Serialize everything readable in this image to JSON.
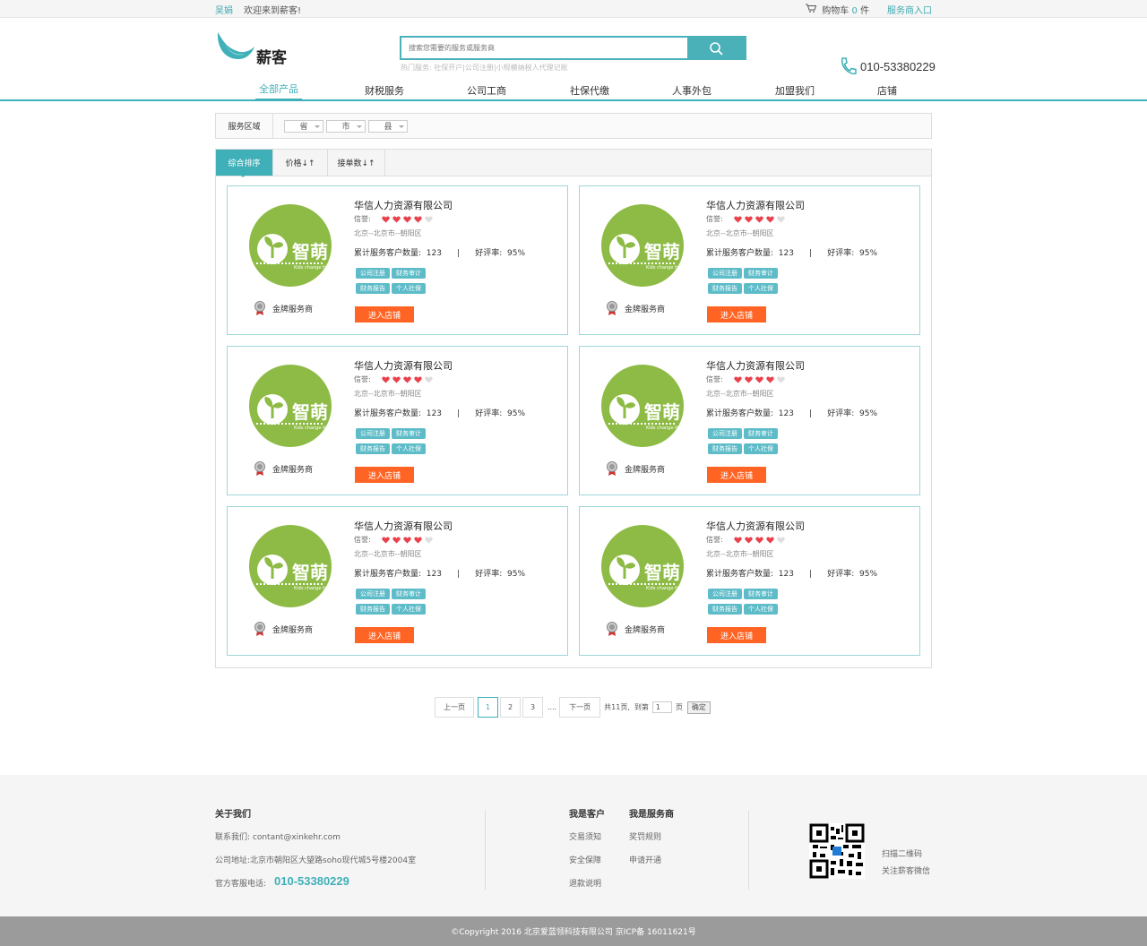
{
  "topbar": {
    "user": "吴娟",
    "welcome": "欢迎来到薪客!",
    "cart_label": "购物车",
    "cart_count": "0",
    "cart_unit": "件",
    "provider_entry": "服务商入口"
  },
  "header": {
    "logo_text": "薪客",
    "search_placeholder": "搜索您需要的服务或服务商",
    "hot_services": "热门服务:  社保开户|公司注册|小规模纳税人代理记账",
    "phone": "010-53380229"
  },
  "nav": [
    "全部产品",
    "财税服务",
    "公司工商",
    "社保代缴",
    "人事外包",
    "加盟我们",
    "店铺"
  ],
  "filter": {
    "label": "服务区域",
    "province": "省",
    "city": "市",
    "county": "县"
  },
  "sort_tabs": [
    "综合排序",
    "价格↓↑",
    "接单数↓↑"
  ],
  "cards": [
    {
      "name": "华信人力资源有限公司",
      "rep_label": "信誉:",
      "rating": 4,
      "location": "北京--北京市--朝阳区",
      "stats": "累计服务客户数量:  123      |      好评率:  95%",
      "tags": [
        "公司注册",
        "财务审计",
        "财务报告",
        "个人社保"
      ],
      "badge": "金牌服务商",
      "enter": "进入店铺",
      "logo_text": "智萌",
      "logo_sub": "Kids change the world"
    },
    {
      "name": "华信人力资源有限公司",
      "rep_label": "信誉:",
      "rating": 4,
      "location": "北京--北京市--朝阳区",
      "stats": "累计服务客户数量:  123      |      好评率:  95%",
      "tags": [
        "公司注册",
        "财务审计",
        "财务报告",
        "个人社保"
      ],
      "badge": "金牌服务商",
      "enter": "进入店铺",
      "logo_text": "智萌",
      "logo_sub": "Kids change the world"
    },
    {
      "name": "华信人力资源有限公司",
      "rep_label": "信誉:",
      "rating": 4,
      "location": "北京--北京市--朝阳区",
      "stats": "累计服务客户数量:  123      |      好评率:  95%",
      "tags": [
        "公司注册",
        "财务审计",
        "财务报告",
        "个人社保"
      ],
      "badge": "金牌服务商",
      "enter": "进入店铺",
      "logo_text": "智萌",
      "logo_sub": "Kids change the world"
    },
    {
      "name": "华信人力资源有限公司",
      "rep_label": "信誉:",
      "rating": 4,
      "location": "北京--北京市--朝阳区",
      "stats": "累计服务客户数量:  123      |      好评率:  95%",
      "tags": [
        "公司注册",
        "财务审计",
        "财务报告",
        "个人社保"
      ],
      "badge": "金牌服务商",
      "enter": "进入店铺",
      "logo_text": "智萌",
      "logo_sub": "Kids change the world"
    },
    {
      "name": "华信人力资源有限公司",
      "rep_label": "信誉:",
      "rating": 4,
      "location": "北京--北京市--朝阳区",
      "stats": "累计服务客户数量:  123      |      好评率:  95%",
      "tags": [
        "公司注册",
        "财务审计",
        "财务报告",
        "个人社保"
      ],
      "badge": "金牌服务商",
      "enter": "进入店铺",
      "logo_text": "智萌",
      "logo_sub": "Kids change the world"
    },
    {
      "name": "华信人力资源有限公司",
      "rep_label": "信誉:",
      "rating": 4,
      "location": "北京--北京市--朝阳区",
      "stats": "累计服务客户数量:  123      |      好评率:  95%",
      "tags": [
        "公司注册",
        "财务审计",
        "财务报告",
        "个人社保"
      ],
      "badge": "金牌服务商",
      "enter": "进入店铺",
      "logo_text": "智萌",
      "logo_sub": "Kids change the world"
    }
  ],
  "pagination": {
    "prev": "上一页",
    "pages": [
      "1",
      "2",
      "3"
    ],
    "current": "1",
    "ellipsis": "....",
    "next": "下一页",
    "total": "共11页,",
    "goto_label": "到第",
    "goto_value": "1",
    "page_unit": "页",
    "confirm": "确定"
  },
  "footer": {
    "about_title": "关于我们",
    "contact": "联系我们: contant@xinkehr.com",
    "address": "公司地址:北京市朝阳区大望路soho现代城5号楼2004室",
    "service_phone_label": "官方客服电话:",
    "service_phone": "010-53380229",
    "customer_title": "我是客户",
    "customer_links": [
      "交易须知",
      "安全保障",
      "退款说明"
    ],
    "provider_title": "我是服务商",
    "provider_links": [
      "奖罚规则",
      "申请开通"
    ],
    "qr_line1": "扫描二维码",
    "qr_line2": "关注薪客微信"
  },
  "copyright": "©Copyright 2016 北京爱蓝领科技有限公司 京ICP备 16011621号",
  "colors": {
    "accent": "#3fb0b8",
    "button": "#ff6424",
    "tag": "#5ebcc9",
    "logo_green": "#8dbb45"
  }
}
